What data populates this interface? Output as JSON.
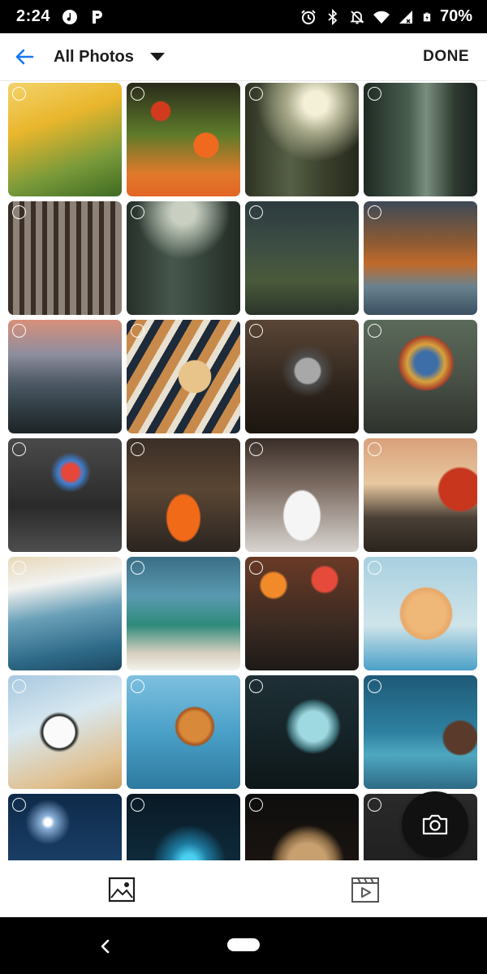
{
  "status_bar": {
    "time": "2:24",
    "battery_text": "70%",
    "icons": [
      "music-note-icon",
      "p-app-icon",
      "alarm-icon",
      "bluetooth-icon",
      "bell-off-icon",
      "wifi-icon",
      "signal-icon",
      "battery-icon"
    ]
  },
  "app_bar": {
    "title": "All Photos",
    "done_label": "DONE",
    "accent_color": "#1877f2"
  },
  "grid": {
    "columns": 4,
    "tiles": [
      {
        "name": "tulips-photo",
        "bg": "linear-gradient(160deg,#f3d36a 0%,#e9b62c 35%,#7a9a3a 70%,#3e6a22 100%)"
      },
      {
        "name": "poppies-photo",
        "bg": "radial-gradient(circle at 30% 25%,#d23a1e 0 8%,transparent 9%),radial-gradient(circle at 70% 55%,#ef6a1f 0 12%,transparent 13%),linear-gradient(180deg,#2a2a1a 0%,#5d7a2a 45%,#e07a2a 80%,#e36525 100%)"
      },
      {
        "name": "forest-sunbeam-photo",
        "bg": "radial-gradient(circle at 62% 18%,#f4f0d8 0 10%,#a8a88a 25%,transparent 50%),linear-gradient(90deg,#2e3322 0%,#566046 40%,#3a3f2c 70%,#262a1c 100%)"
      },
      {
        "name": "misty-forest-photo",
        "bg": "linear-gradient(90deg,#1e2a22 0%,#4a5e50 40%,#7a8e7e 55%,#2e3a30 80%,#1c2420 100%)"
      },
      {
        "name": "pine-trunks-photo",
        "bg": "repeating-linear-gradient(90deg,#3b2e26 0 6px,#8c8278 6px 14px),linear-gradient(180deg,#c8c0b6,#4a3a2c)"
      },
      {
        "name": "foggy-woods-photo",
        "bg": "radial-gradient(circle at 50% 10%,#c9d0c2 0 10%,transparent 40%),linear-gradient(90deg,#26302a 0%,#46574c 40%,#3a4a40 60%,#222a24 100%)"
      },
      {
        "name": "waterfall-cliffs-photo",
        "bg": "linear-gradient(180deg,#2c3a3e 0%,#3d4e44 40%,#4a5a3a 70%,#2a342a 100%)"
      },
      {
        "name": "autumn-lake-photo",
        "bg": "linear-gradient(180deg,#3e4a58 0%,#8a5a34 35%,#c06a2a 55%,#6a8290 75%,#3a5060 100%)"
      },
      {
        "name": "lake-steps-photo",
        "bg": "linear-gradient(180deg,#d88f7a 0%,#8e8e9e 30%,#4e5a66 55%,#2e3a40 80%,#1e2428 100%)"
      },
      {
        "name": "tiger-photo",
        "bg": "radial-gradient(circle at 60% 50%,#e9c48a 0 18%,transparent 19%),repeating-linear-gradient(120deg,#1d2a3a 0 10px,#c88a4a 10px 22px,#e8e0d0 22px 30px)"
      },
      {
        "name": "heart-pendant-photo",
        "bg": "radial-gradient(circle at 55% 45%,#a8a8a8 0 14%,#4e4e4e 16%,transparent 30%),linear-gradient(180deg,#5a4636 0%,#2e241c 60%,#1c1610 100%)"
      },
      {
        "name": "hot-air-balloon-photo",
        "bg": "radial-gradient(circle at 55% 38%,#3e6ea8 0 12%,#d9a23a 20%,#a8442c 28%,transparent 30%),linear-gradient(180deg,#5a6a5a 0%,#4a5248 50%,#2e322c 100%)"
      },
      {
        "name": "rain-umbrella-photo",
        "bg": "radial-gradient(circle at 55% 30%,#e7463a 0 8%,#3d7fd0 12%,transparent 20%),linear-gradient(180deg,#4a4a4a 0%,#2a2a2a 60%,#4e4e4e 100%)"
      },
      {
        "name": "orange-supercar-photo",
        "bg": "radial-gradient(ellipse at 50% 70%,#f06a18 0 20%,transparent 22%),linear-gradient(180deg,#3a2e26 0%,#5a4634 45%,#2a2420 100%)"
      },
      {
        "name": "coffee-cup-photo",
        "bg": "radial-gradient(ellipse at 50% 68%,#f5f5f5 0 22%,transparent 24%),linear-gradient(180deg,#3a2e28 0%,#7a6a60 40%,#d8d4d0 100%)"
      },
      {
        "name": "vintage-car-sunset-photo",
        "bg": "radial-gradient(circle at 85% 45%,#c8361e 0 18%,transparent 20%),linear-gradient(180deg,#d9a07a 0%,#e8c8a0 40%,#4a4036 70%,#2a241e 100%)"
      },
      {
        "name": "snowy-mountain-photo",
        "bg": "linear-gradient(170deg,#e8d8b8 0%,#f2f2f0 25%,#6aa0b8 50%,#2e6a88 80%,#1e4a64 100%)"
      },
      {
        "name": "island-ship-photo",
        "bg": "linear-gradient(180deg,#3a6f86 0%,#5a9ab0 35%,#2e8a7a 60%,#d8d0c0 85%,#f2f2ec 100%)"
      },
      {
        "name": "bokeh-eiffel-photo",
        "bg": "radial-gradient(circle at 25% 25%,#f28a2a 0 10%,transparent 12%),radial-gradient(circle at 70% 20%,#e64a3a 0 10%,transparent 12%),linear-gradient(180deg,#6a3a26 0%,#3a2a22 60%,#1e1a18 100%)"
      },
      {
        "name": "kitten-photo",
        "bg": "radial-gradient(circle at 55% 50%,#f0b878 0 22%,#e8a868 30%,transparent 32%),linear-gradient(180deg,#a8d0e0 0%,#cfe4ea 60%,#4aa0c8 100%)"
      },
      {
        "name": "kung-fu-panda-photo",
        "bg": "radial-gradient(circle at 45% 50%,#fafafa 0 18%,#1a1a1a 20%,transparent 24%),linear-gradient(160deg,#a8c8e0 0%,#d8e8f0 40%,#e0c090 80%,#c8a060 100%)"
      },
      {
        "name": "autumn-leaf-photo",
        "bg": "radial-gradient(circle at 60% 45%,#d88a3a 0 16%,#a8541e 20%,transparent 22%),linear-gradient(180deg,#7ec0e0 0%,#4aa0c8 50%,#2e7aa0 100%)"
      },
      {
        "name": "glowing-skull-photo",
        "bg": "radial-gradient(circle at 60% 45%,#9ed8e0 0 16%,#3a6a72 26%,transparent 30%),linear-gradient(180deg,#1e3036 0%,#142226 60%,#0e1618 100%)"
      },
      {
        "name": "cookie-photo",
        "bg": "radial-gradient(circle at 85% 55%,#5a3a2a 0 14%,transparent 16%),linear-gradient(180deg,#1e5a78 0%,#2e80a0 50%,#4ea8c0 70%,#2e6a88 100%)"
      },
      {
        "name": "moonlit-night-photo",
        "bg": "radial-gradient(circle at 35% 25%,#ffffff 0 3%,#8ab0d8 6%,transparent 20%),linear-gradient(180deg,#0e2a4a 0%,#1a3e66 60%,#2a4e78 100%)"
      },
      {
        "name": "blue-fireworks-photo",
        "bg": "radial-gradient(circle at 55% 60%,#4ad0f0 0 8%,#1e7aa0 20%,transparent 40%),linear-gradient(180deg,#0a1a26 0%,#0e2a3a 60%,#081018 100%)"
      },
      {
        "name": "lion-photo",
        "bg": "radial-gradient(circle at 55% 60%,#c8a070 0 20%,#8a6a44 30%,transparent 40%),linear-gradient(180deg,#0e0e0e 0%,#1a1410 60%,#2a2018 100%)"
      },
      {
        "name": "dark-text-photo",
        "bg": "linear-gradient(180deg,#2a2a2a 0%,#1a1a1a 100%)"
      }
    ]
  },
  "fab": {
    "icon": "camera-icon"
  },
  "bottom_tabs": [
    {
      "name": "photos-tab",
      "icon": "image-icon"
    },
    {
      "name": "videos-tab",
      "icon": "video-clapper-icon"
    }
  ],
  "nav_bar": {
    "back_icon": "nav-back-icon",
    "home_icon": "home-pill-icon"
  }
}
